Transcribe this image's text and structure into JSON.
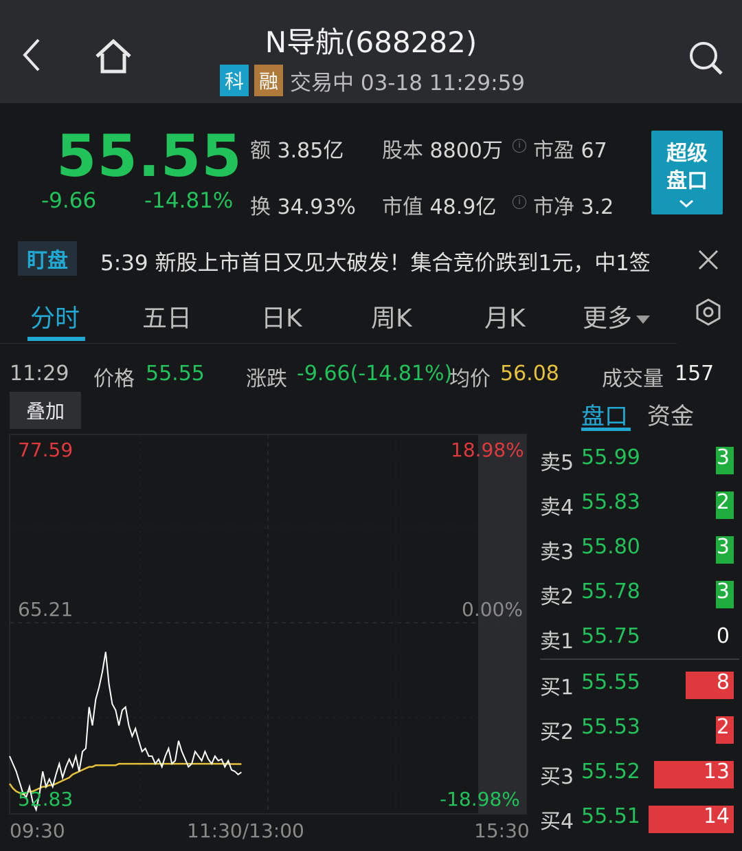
{
  "header": {
    "title": "N导航(688282)",
    "tag_ke": "科",
    "tag_rong": "融",
    "status": "交易中 03-18 11:29:59"
  },
  "quote": {
    "price": "55.55",
    "change": "-9.66",
    "change_pct": "-14.81%",
    "amount_label": "额",
    "amount": "3.85亿",
    "turnover_label": "换",
    "turnover": "34.93%",
    "share_capital_label": "股本",
    "share_capital": "8800万",
    "market_value_label": "市值",
    "market_value": "48.9亿",
    "pe_label": "市盈",
    "pe": "67",
    "pb_label": "市净",
    "pb": "3.2",
    "super_btn_line1": "超级",
    "super_btn_line2": "盘口"
  },
  "ticker": {
    "tag": "盯盘",
    "text": "5:39 新股上市首日又见大破发！集合竞价跌到1元，中1签"
  },
  "tabs": [
    {
      "label": "分时"
    },
    {
      "label": "五日"
    },
    {
      "label": "日K"
    },
    {
      "label": "周K"
    },
    {
      "label": "月K"
    },
    {
      "label": "更多"
    }
  ],
  "infoline": {
    "time": "11:29",
    "price_label": "价格",
    "price": "55.55",
    "change_label": "涨跌",
    "change": "-9.66(-14.81%)",
    "avg_label": "均价",
    "avg": "56.08",
    "volume_label": "成交量",
    "volume": "157"
  },
  "overlay_btn": "叠加",
  "side_tabs": [
    "盘口",
    "资金"
  ],
  "chart_data": {
    "type": "line",
    "y_left": {
      "max": "77.59",
      "mid": "65.21",
      "min": "52.83"
    },
    "y_right": {
      "max": "18.98%",
      "mid": "0.00%",
      "min": "-18.98%"
    },
    "x_labels": [
      "09:30",
      "11:30/13:00",
      "15:30"
    ],
    "ylim": [
      52.83,
      77.59
    ],
    "price_series": [
      56.6,
      56.1,
      55.6,
      54.9,
      54.2,
      53.9,
      54.6,
      53.6,
      53.1,
      54.1,
      55.6,
      54.6,
      55.1,
      54.6,
      55.4,
      56.1,
      55.2,
      55.9,
      56.4,
      55.9,
      56.6,
      55.6,
      56.9,
      57.1,
      59.8,
      58.6,
      60.3,
      61.1,
      62.1,
      63.4,
      61.3,
      60.0,
      59.6,
      58.6,
      59.6,
      59.8,
      58.6,
      57.9,
      58.4,
      57.6,
      56.9,
      57.1,
      56.6,
      56.6,
      56.1,
      56.4,
      55.9,
      56.6,
      57.1,
      56.1,
      56.3,
      57.6,
      56.9,
      56.4,
      55.9,
      56.1,
      56.9,
      56.6,
      56.3,
      56.9,
      56.4,
      56.1,
      56.6,
      56.3,
      56.4,
      55.9,
      56.3,
      55.7,
      55.6,
      55.4,
      55.55
    ],
    "avg_series": [
      54.8,
      54.5,
      54.3,
      54.2,
      54.1,
      54.2,
      54.3,
      54.3,
      54.4,
      54.5,
      54.6,
      54.6,
      54.7,
      54.7,
      54.8,
      54.9,
      55.0,
      55.1,
      55.2,
      55.4,
      55.5,
      55.6,
      55.7,
      55.8,
      55.9,
      55.9,
      56.0,
      56.0,
      56.0,
      56.0,
      56.0,
      56.0,
      56.0,
      56.1,
      56.1,
      56.1,
      56.1,
      56.1,
      56.1,
      56.1,
      56.1,
      56.1,
      56.1,
      56.1,
      56.1,
      56.1,
      56.1,
      56.1,
      56.1,
      56.1,
      56.1,
      56.1,
      56.1,
      56.1,
      56.1,
      56.1,
      56.1,
      56.1,
      56.1,
      56.1,
      56.1,
      56.1,
      56.1,
      56.1,
      56.1,
      56.1,
      56.1,
      56.08,
      56.08,
      56.08,
      56.08
    ],
    "colors": {
      "price_line": "#ffffff",
      "avg_line": "#e8c13a"
    }
  },
  "order_book": [
    {
      "label": "卖5",
      "price": "55.99",
      "volume": "3",
      "side": "sell",
      "bar_frac": 0.12
    },
    {
      "label": "卖4",
      "price": "55.83",
      "volume": "2",
      "side": "sell",
      "bar_frac": 0.1
    },
    {
      "label": "卖3",
      "price": "55.80",
      "volume": "3",
      "side": "sell",
      "bar_frac": 0.12
    },
    {
      "label": "卖2",
      "price": "55.78",
      "volume": "3",
      "side": "sell",
      "bar_frac": 0.12
    },
    {
      "label": "卖1",
      "price": "55.75",
      "volume": "0",
      "side": "sell",
      "bar_frac": 0
    },
    {
      "label": "买1",
      "price": "55.55",
      "volume": "8",
      "side": "buy",
      "bar_frac": 0.35
    },
    {
      "label": "买2",
      "price": "55.53",
      "volume": "2",
      "side": "buy",
      "bar_frac": 0.1
    },
    {
      "label": "买3",
      "price": "55.52",
      "volume": "13",
      "side": "buy",
      "bar_frac": 0.58
    },
    {
      "label": "买4",
      "price": "55.51",
      "volume": "14",
      "side": "buy",
      "bar_frac": 0.62
    }
  ]
}
